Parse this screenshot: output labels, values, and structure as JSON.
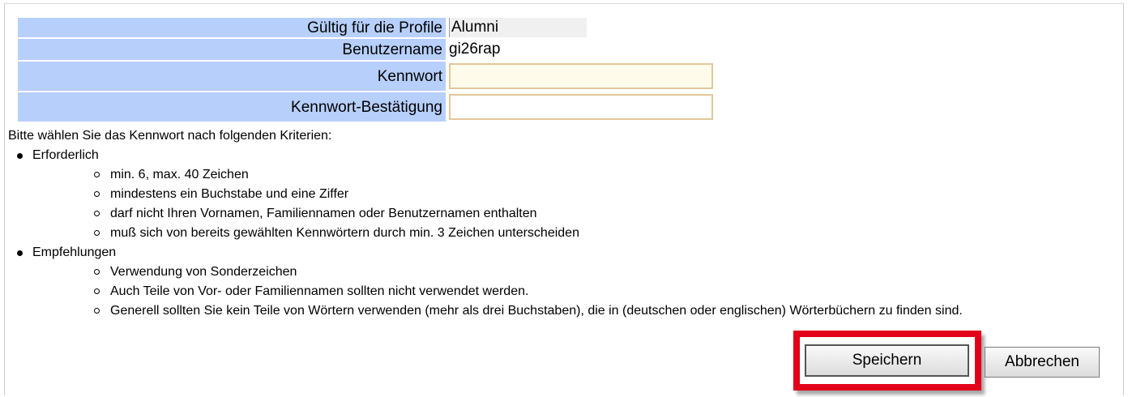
{
  "form": {
    "profile_label": "Gültig für die Profile",
    "profile_value": "Alumni",
    "username_label": "Benutzername",
    "username_value": "gi26rap",
    "password_label": "Kennwort",
    "password_value": "",
    "confirm_label": "Kennwort-Bestätigung",
    "confirm_value": ""
  },
  "criteria": {
    "intro": "Bitte wählen Sie das Kennwort nach folgenden Kriterien:",
    "required_title": "Erforderlich",
    "required": [
      "min. 6, max. 40 Zeichen",
      "mindestens ein Buchstabe und eine Ziffer",
      "darf nicht Ihren Vornamen, Familiennamen oder Benutzernamen enthalten",
      "muß sich von bereits gewählten Kennwörtern durch min. 3 Zeichen unterscheiden"
    ],
    "recommended_title": "Empfehlungen",
    "recommended": [
      "Verwendung von Sonderzeichen",
      "Auch Teile von Vor- oder Familiennamen sollten nicht verwendet werden.",
      "Generell sollten Sie kein Teile von Wörtern verwenden (mehr als drei Buchstaben), die in (deutschen oder englischen) Wörterbüchern zu finden sind."
    ]
  },
  "buttons": {
    "save": "Speichern",
    "cancel": "Abbrechen"
  },
  "colors": {
    "label_bg": "#b7cffb",
    "highlight": "#e2001a",
    "input_border": "#e3c79a"
  }
}
